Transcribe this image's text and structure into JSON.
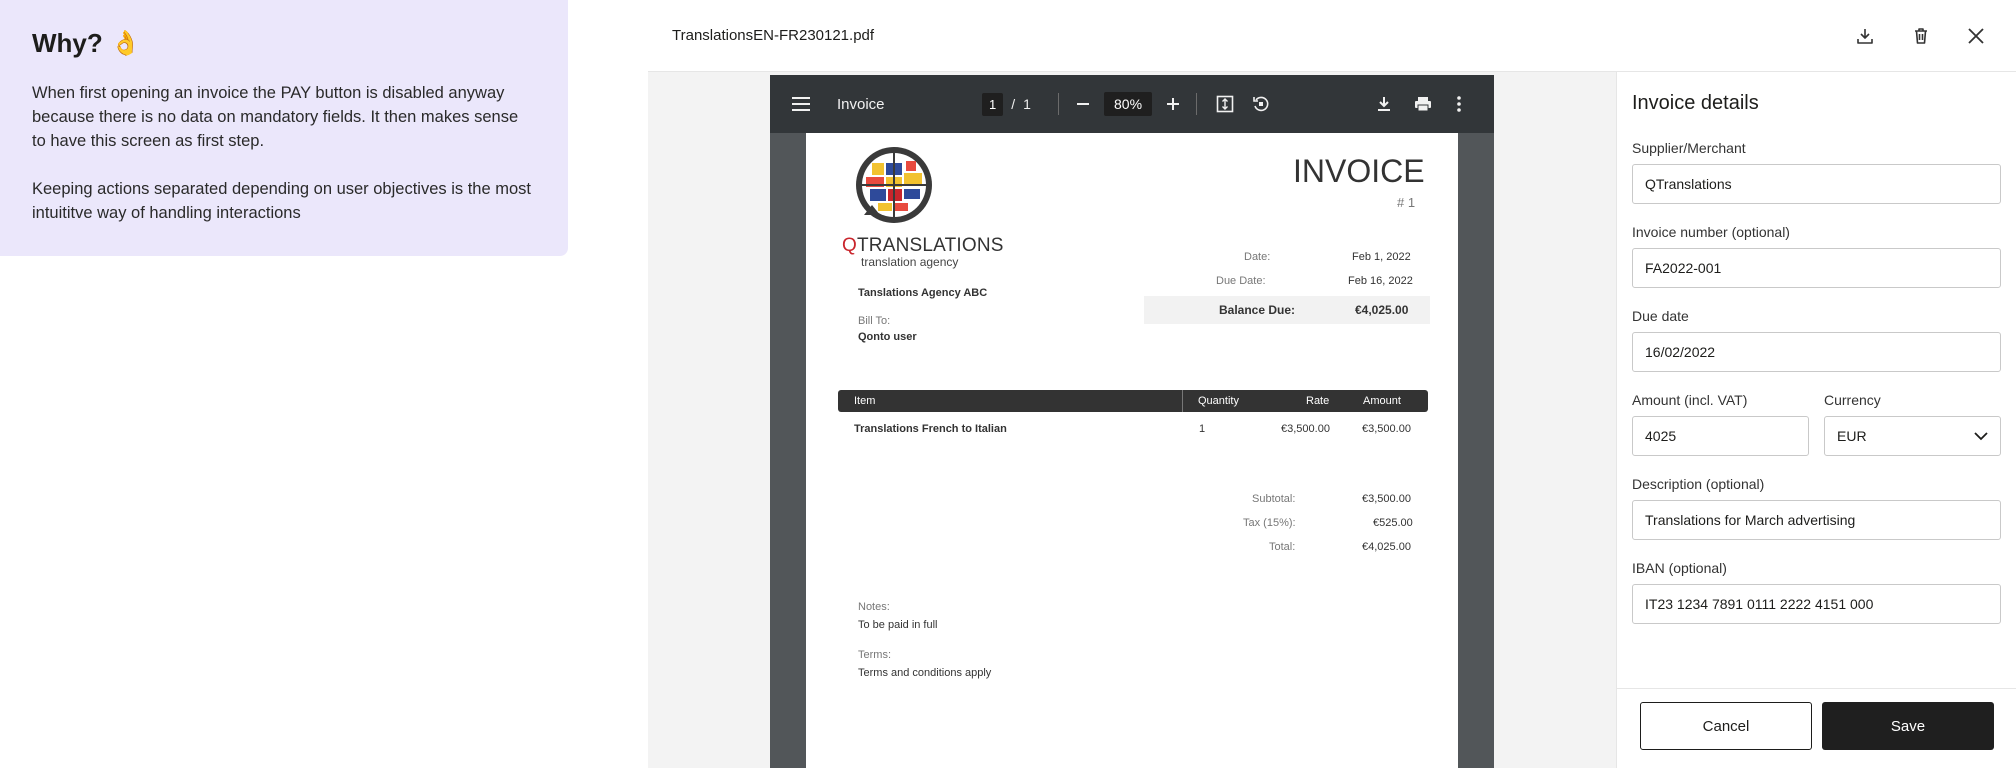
{
  "note": {
    "title": "Why?",
    "emoji": "👌",
    "paragraph1": "When first opening an invoice the PAY button is disabled anyway because there is no data on mandatory fields. It then makes sense to have this screen as first step.",
    "paragraph2": "Keeping actions separated depending on user objectives is the most intuititve way of handling interactions"
  },
  "viewer": {
    "filename": "TranslationsEN-FR230121.pdf",
    "header_icons": [
      "download-icon",
      "trash-icon",
      "close-icon"
    ]
  },
  "pdf_toolbar": {
    "title": "Invoice",
    "page_current": "1",
    "page_separator": "/",
    "page_total": "1",
    "zoom": "80%"
  },
  "invoice": {
    "logo_word_q": "Q",
    "logo_word_rest": "TRANSLATIONS",
    "logo_sub": "translation agency",
    "heading": "INVOICE",
    "number": "# 1",
    "from": "Tanslations Agency ABC",
    "bill_to_label": "Bill To:",
    "bill_to": "Qonto user",
    "date_label": "Date:",
    "date": "Feb 1, 2022",
    "due_date_label": "Due Date:",
    "due_date": "Feb 16, 2022",
    "balance_label": "Balance Due:",
    "balance": "€4,025.00",
    "table_headers": [
      "Item",
      "Quantity",
      "Rate",
      "Amount"
    ],
    "row": {
      "item": "Translations French to Italian",
      "quantity": "1",
      "rate": "€3,500.00",
      "amount": "€3,500.00"
    },
    "subtotal_label": "Subtotal:",
    "subtotal": "€3,500.00",
    "tax_label": "Tax (15%):",
    "tax": "€525.00",
    "total_label": "Total:",
    "total": "€4,025.00",
    "notes_label": "Notes:",
    "notes": "To be paid in full",
    "terms_label": "Terms:",
    "terms": "Terms and conditions apply"
  },
  "form": {
    "title": "Invoice details",
    "supplier_label": "Supplier/Merchant",
    "supplier_value": "QTranslations",
    "invoice_number_label": "Invoice number (optional)",
    "invoice_number_value": "FA2022-001",
    "due_date_label": "Due date",
    "due_date_value": "16/02/2022",
    "amount_label": "Amount (incl. VAT)",
    "amount_value": "4025",
    "currency_label": "Currency",
    "currency_value": "EUR",
    "description_label": "Description (optional)",
    "description_value": "Translations for March advertising",
    "iban_label": "IBAN (optional)",
    "iban_value": "IT23 1234 7891 0111 2222 4151 000",
    "cancel_label": "Cancel",
    "save_label": "Save"
  }
}
